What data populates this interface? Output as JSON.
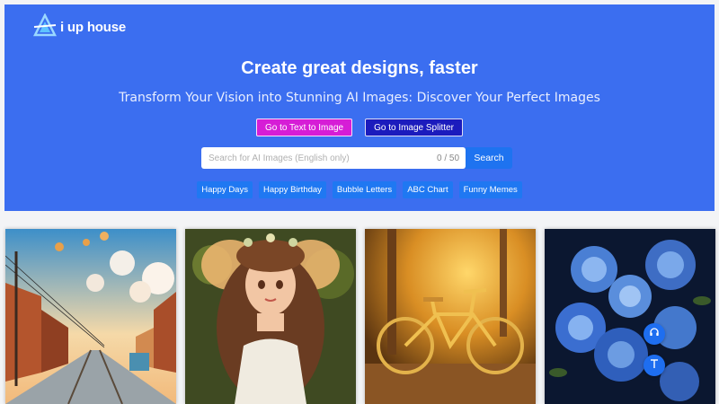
{
  "brand": {
    "name": "i up house",
    "logo_icon": "triangle-a-logo-icon"
  },
  "hero": {
    "title": "Create great designs, faster",
    "subtitle": "Transform Your Vision into Stunning AI Images: Discover Your Perfect Images"
  },
  "actions": {
    "text_to_image": "Go to Text to Image",
    "image_splitter": "Go to Image Splitter"
  },
  "search": {
    "placeholder": "Search for AI Images (English only)",
    "value": "",
    "counter": "0 / 50",
    "button": "Search"
  },
  "tags": [
    "Happy Days",
    "Happy Birthday",
    "Bubble Letters",
    "ABC Chart",
    "Funny Memes"
  ],
  "gallery": [
    {
      "subject": "street-with-power-lines-and-balloons"
    },
    {
      "subject": "fairy-girl-with-wings"
    },
    {
      "subject": "golden-bicycle"
    },
    {
      "subject": "blue-roses-bouquet"
    }
  ],
  "floating": {
    "support_icon": "headset-icon",
    "top_icon": "arrow-to-top-icon"
  },
  "colors": {
    "hero_bg": "#3b6ef0",
    "primary": "#1e73f0",
    "pink_button": "#d61dd6",
    "navy_button": "#1b1bbd"
  }
}
